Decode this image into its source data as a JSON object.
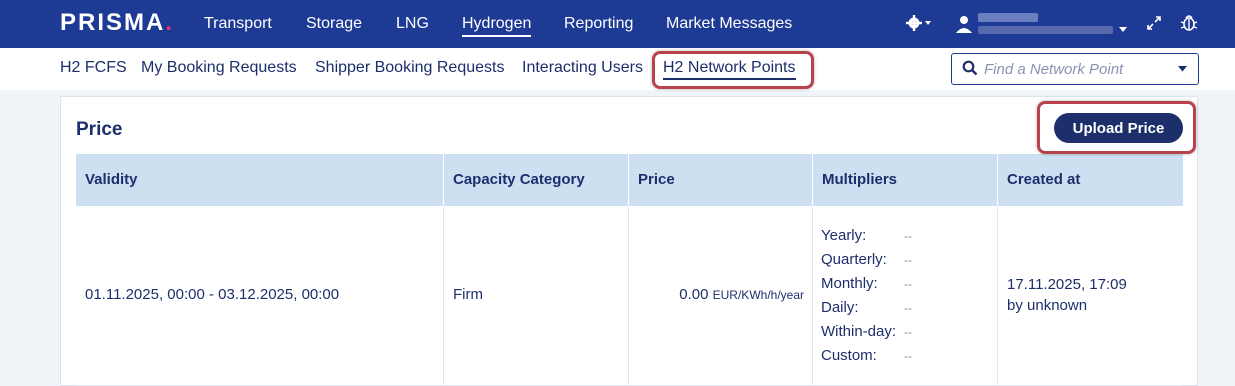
{
  "header": {
    "logo_text": "PRISMA",
    "logo_dot": ".",
    "nav": [
      {
        "label": "Transport"
      },
      {
        "label": "Storage"
      },
      {
        "label": "LNG"
      },
      {
        "label": "Hydrogen"
      },
      {
        "label": "Reporting"
      },
      {
        "label": "Market Messages"
      }
    ],
    "active_nav": "Hydrogen",
    "settings_icon": "gear-icon",
    "user_icon": "user-icon",
    "expand_icon": "expand-icon",
    "bug_icon": "bug-icon"
  },
  "subnav": {
    "items": [
      {
        "label": "H2 FCFS"
      },
      {
        "label": "My Booking Requests"
      },
      {
        "label": "Shipper Booking Requests"
      },
      {
        "label": "Interacting Users"
      },
      {
        "label": "H2 Network Points"
      }
    ],
    "active": "H2 Network Points",
    "search_placeholder": "Find a Network Point"
  },
  "card": {
    "title": "Price",
    "upload_button": "Upload Price"
  },
  "table": {
    "columns": [
      "Validity",
      "Capacity Category",
      "Price",
      "Multipliers",
      "Created at"
    ],
    "rows": [
      {
        "validity": "01.11.2025, 00:00 - 03.12.2025, 00:00",
        "capacity_category": "Firm",
        "price_value": "0.00",
        "price_unit": "EUR/KWh/h/year",
        "multipliers": [
          {
            "label": "Yearly:",
            "value": "--"
          },
          {
            "label": "Quarterly:",
            "value": "--"
          },
          {
            "label": "Monthly:",
            "value": "--"
          },
          {
            "label": "Daily:",
            "value": "--"
          },
          {
            "label": "Within-day:",
            "value": "--"
          },
          {
            "label": "Custom:",
            "value": "--"
          }
        ],
        "created_date": "17.11.2025, 17:09",
        "created_by": "by unknown"
      }
    ]
  },
  "colors": {
    "topbar": "#1d3a94",
    "accent": "#e8336f",
    "text": "#1d2f6b",
    "table_header": "#cde0f2",
    "highlight": "#b8434c"
  }
}
